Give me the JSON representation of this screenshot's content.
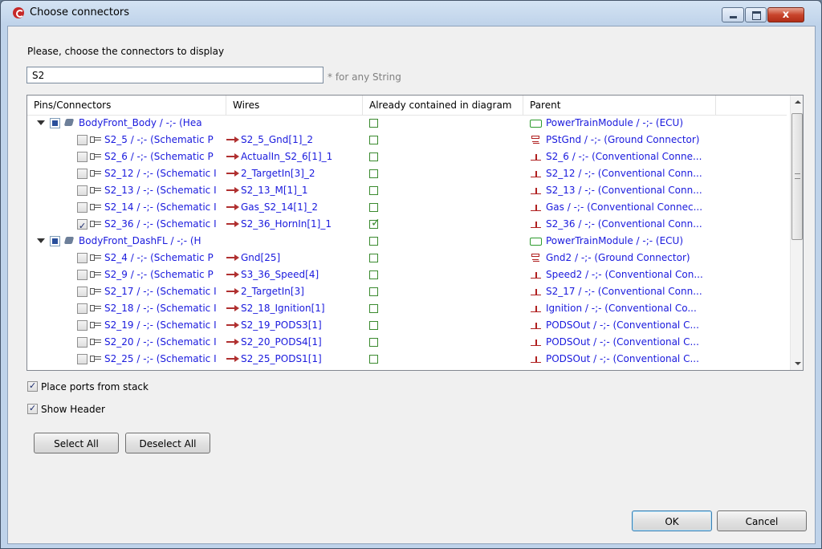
{
  "window": {
    "title": "Choose connectors",
    "close_glyph": "x"
  },
  "prompt": "Please, choose the connectors to display",
  "search": {
    "value": "S2",
    "hint": "* for any String"
  },
  "columns": [
    "Pins/Connectors",
    "Wires",
    "Already contained in diagram",
    "Parent"
  ],
  "rows": [
    {
      "type": "group",
      "name": "BodyFront_Body / -;- (Hea",
      "contained": false,
      "parent_icon": "ecu-icon",
      "parent": "PowerTrainModule / -;- (ECU)"
    },
    {
      "type": "pin",
      "checked": false,
      "name": "S2_5 / -;- (Schematic P",
      "wire": "S2_5_Gnd[1]_2",
      "contained": false,
      "parent_icon": "ground-icon",
      "parent": "PStGnd / -;- (Ground Connector)"
    },
    {
      "type": "pin",
      "checked": false,
      "name": "S2_6 / -;- (Schematic P",
      "wire": "ActualIn_S2_6[1]_1",
      "contained": false,
      "parent_icon": "connector-icon",
      "parent": "S2_6 / -;- (Conventional Conne..."
    },
    {
      "type": "pin",
      "checked": false,
      "name": "S2_12 / -;- (Schematic I",
      "wire": "2_TargetIn[3]_2",
      "contained": false,
      "parent_icon": "connector-icon",
      "parent": "S2_12 / -;- (Conventional Conn..."
    },
    {
      "type": "pin",
      "checked": false,
      "name": "S2_13 / -;- (Schematic I",
      "wire": "S2_13_M[1]_1",
      "contained": false,
      "parent_icon": "connector-icon",
      "parent": "S2_13 / -;- (Conventional Conn..."
    },
    {
      "type": "pin",
      "checked": false,
      "name": "S2_14 / -;- (Schematic I",
      "wire": "Gas_S2_14[1]_2",
      "contained": false,
      "parent_icon": "connector-icon",
      "parent": "Gas / -;- (Conventional Connec..."
    },
    {
      "type": "pin",
      "checked": true,
      "name": "S2_36 / -;- (Schematic I",
      "wire": "S2_36_HornIn[1]_1",
      "contained": true,
      "parent_icon": "connector-icon",
      "parent": "S2_36 / -;- (Conventional Conn..."
    },
    {
      "type": "group",
      "name": "BodyFront_DashFL / -;- (H",
      "contained": false,
      "parent_icon": "ecu-icon",
      "parent": "PowerTrainModule / -;- (ECU)"
    },
    {
      "type": "pin",
      "checked": false,
      "name": "S2_4 / -;- (Schematic P",
      "wire": "Gnd[25]",
      "contained": false,
      "parent_icon": "ground-icon",
      "parent": "Gnd2 / -;- (Ground Connector)"
    },
    {
      "type": "pin",
      "checked": false,
      "name": "S2_9 / -;- (Schematic P",
      "wire": "S3_36_Speed[4]",
      "contained": false,
      "parent_icon": "connector-icon",
      "parent": "Speed2 / -;- (Conventional Con..."
    },
    {
      "type": "pin",
      "checked": false,
      "name": "S2_17 / -;- (Schematic I",
      "wire": "2_TargetIn[3]",
      "contained": false,
      "parent_icon": "connector-icon",
      "parent": "S2_17 / -;- (Conventional Conn..."
    },
    {
      "type": "pin",
      "checked": false,
      "name": "S2_18 / -;- (Schematic I",
      "wire": "S2_18_Ignition[1]",
      "contained": false,
      "parent_icon": "connector-icon",
      "parent": "Ignition / -;- (Conventional Co..."
    },
    {
      "type": "pin",
      "checked": false,
      "name": "S2_19 / -;- (Schematic I",
      "wire": "S2_19_PODS3[1]",
      "contained": false,
      "parent_icon": "connector-icon",
      "parent": "PODSOut / -;- (Conventional C..."
    },
    {
      "type": "pin",
      "checked": false,
      "name": "S2_20 / -;- (Schematic I",
      "wire": "S2_20_PODS4[1]",
      "contained": false,
      "parent_icon": "connector-icon",
      "parent": "PODSOut / -;- (Conventional C..."
    },
    {
      "type": "pin",
      "checked": false,
      "name": "S2_25 / -;- (Schematic I",
      "wire": "S2_25_PODS1[1]",
      "contained": false,
      "parent_icon": "connector-icon",
      "parent": "PODSOut / -;- (Conventional C..."
    }
  ],
  "options": {
    "place_ports": {
      "label": "Place ports from stack",
      "checked": true
    },
    "show_header": {
      "label": "Show Header",
      "checked": true
    }
  },
  "buttons": {
    "select_all": "Select All",
    "deselect_all": "Deselect All",
    "ok": "OK",
    "cancel": "Cancel"
  },
  "colors": {
    "link_text": "#1a1add",
    "wire_arrow": "#b03030",
    "contained_green": "#3a8a2e",
    "ecu_green": "#2d9b2d"
  }
}
